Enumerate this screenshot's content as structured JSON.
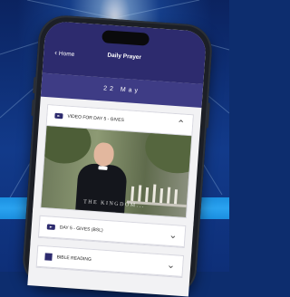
{
  "header": {
    "back_label": "Home",
    "title": "Daily Prayer"
  },
  "date": "22 May",
  "sections": {
    "video": {
      "label": "VIDEO FOR DAY 5 - GIVES",
      "expanded": true
    },
    "video_watermark": "THE KINGDOM...",
    "bsl": {
      "label": "DAY 5 - GIVES (BSL)"
    },
    "bible": {
      "label": "BIBLE READING"
    }
  },
  "colors": {
    "header": "#2d2b6e",
    "datebar": "#3e3c85",
    "background": "#0d2d6e",
    "stripe": "#1b8fe0"
  },
  "icons": {
    "back": "chevron-left-icon",
    "video": "play-icon",
    "bible": "book-icon",
    "collapse": "chevron-up-icon",
    "expand": "chevron-down-icon"
  }
}
